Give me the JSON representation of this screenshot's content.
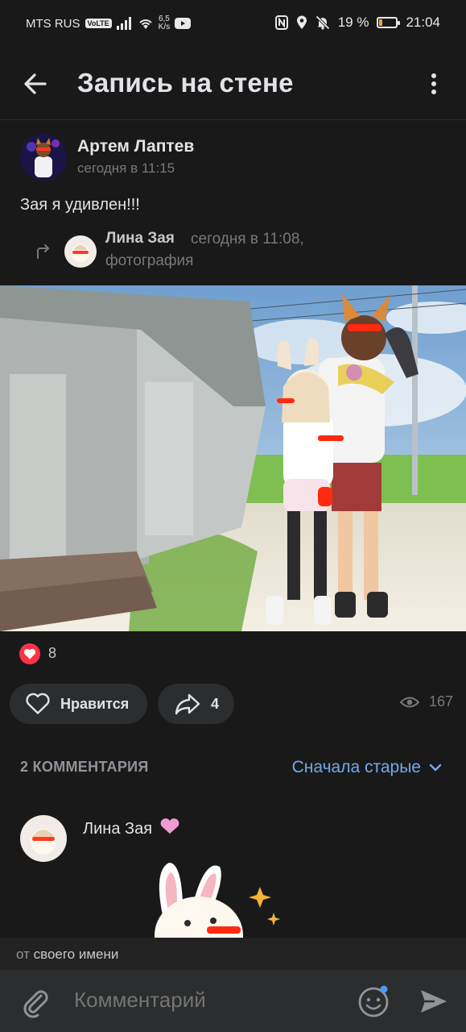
{
  "status_bar": {
    "carrier": "MTS RUS",
    "volte": "VoLTE",
    "speed_value": "6,5",
    "speed_unit": "K/s",
    "battery": "19 %",
    "battery_level": 0.19,
    "time": "21:04"
  },
  "header": {
    "title": "Запись на стене"
  },
  "post": {
    "author": "Артем Лаптев",
    "time": "сегодня в 11:15",
    "text": "Зая я удивлен!!!",
    "repost": {
      "author": "Лина Зая",
      "time": "сегодня в 11:08,",
      "type": "фотография"
    }
  },
  "reactions": {
    "likes": "8",
    "like_label": "Нравится",
    "shares": "4",
    "views": "167"
  },
  "comments": {
    "title": "2 КОММЕНТАРИЯ",
    "sort": "Сначала старые",
    "items": [
      {
        "author": "Лина Зая"
      }
    ]
  },
  "compose": {
    "from_prefix": "от",
    "from_name": "своего имени",
    "placeholder": "Комментарий"
  },
  "colors": {
    "background": "#19191a",
    "accent": "#71aaeb",
    "like": "#ff3347",
    "surface": "#2c2d2e"
  }
}
